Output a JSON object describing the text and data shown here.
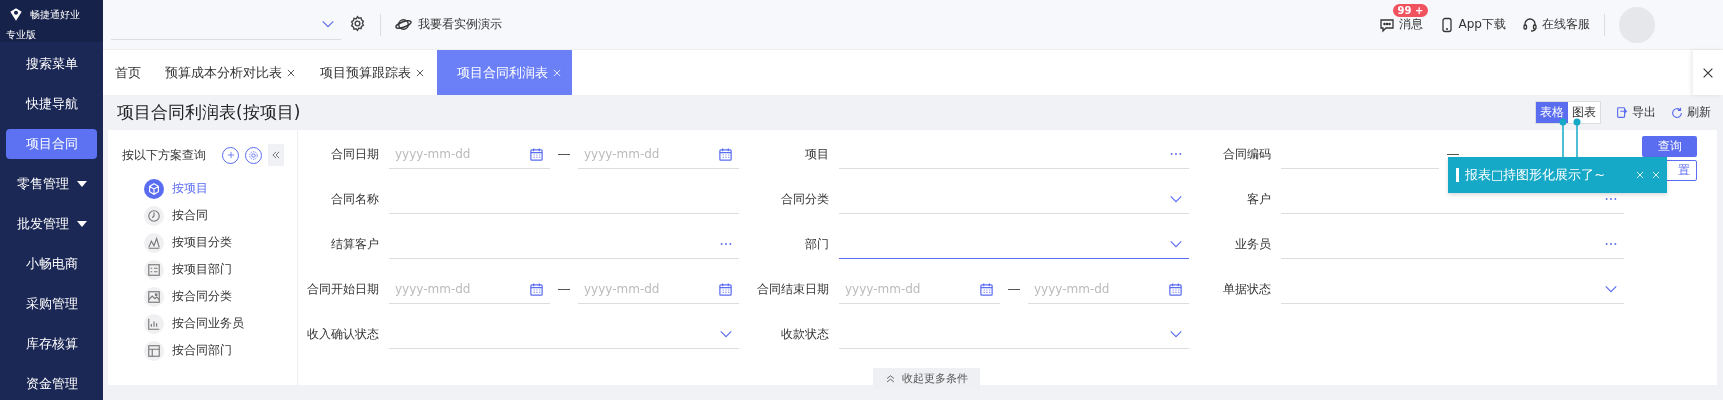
{
  "sidebar": {
    "brand": "畅捷通好业",
    "edition": "专业版",
    "items": [
      {
        "label": "搜索菜单",
        "selected": false,
        "expandable": false
      },
      {
        "label": "快捷导航",
        "selected": false,
        "expandable": false
      },
      {
        "label": "项目合同",
        "selected": true,
        "expandable": false
      },
      {
        "label": "零售管理",
        "selected": false,
        "expandable": true
      },
      {
        "label": "批发管理",
        "selected": false,
        "expandable": true
      },
      {
        "label": "小畅电商",
        "selected": false,
        "expandable": false
      },
      {
        "label": "采购管理",
        "selected": false,
        "expandable": false
      },
      {
        "label": "库存核算",
        "selected": false,
        "expandable": false
      },
      {
        "label": "资金管理",
        "selected": false,
        "expandable": false
      }
    ]
  },
  "topbar": {
    "demo_link": "我要看实例演示",
    "messages": {
      "label": "消息",
      "badge": "99 +"
    },
    "app_download": "App下载",
    "support": "在线客服"
  },
  "tabs": [
    {
      "label": "首页",
      "closable": false,
      "selected": false
    },
    {
      "label": "预算成本分析对比表",
      "closable": true,
      "selected": false
    },
    {
      "label": "项目预算跟踪表",
      "closable": true,
      "selected": false
    },
    {
      "label": "项目合同利润表",
      "closable": true,
      "selected": true
    }
  ],
  "page": {
    "title": "项目合同利润表(按项目)",
    "view_toggle": [
      {
        "label": "表格",
        "selected": true
      },
      {
        "label": "图表",
        "selected": false
      }
    ],
    "actions": [
      {
        "kind": "export",
        "label": "导出"
      },
      {
        "kind": "refresh",
        "label": "刷新"
      }
    ]
  },
  "schemes": {
    "title": "按以下方案查询",
    "items": [
      {
        "label": "按项目",
        "kind": "cube",
        "selected": true
      },
      {
        "label": "按合同",
        "kind": "clock",
        "selected": false
      },
      {
        "label": "按项目分类",
        "kind": "line",
        "selected": false
      },
      {
        "label": "按项目部门",
        "kind": "list",
        "selected": false
      },
      {
        "label": "按合同分类",
        "kind": "image",
        "selected": false
      },
      {
        "label": "按合同业务员",
        "kind": "bars",
        "selected": false
      },
      {
        "label": "按合同部门",
        "kind": "layout",
        "selected": false
      }
    ]
  },
  "form": {
    "fields": [
      {
        "label": "合同日期",
        "kind": "date_range",
        "placeholder_from": "yyyy-mm-dd",
        "placeholder_to": "yyyy-mm-dd",
        "focused": false
      },
      {
        "label": "项目",
        "kind": "lookup",
        "focused": false
      },
      {
        "label": "合同编码",
        "kind": "text_range",
        "focused": false
      },
      {
        "label": "合同名称",
        "kind": "text",
        "focused": false
      },
      {
        "label": "合同分类",
        "kind": "select",
        "focused": false
      },
      {
        "label": "客户",
        "kind": "lookup",
        "focused": false
      },
      {
        "label": "结算客户",
        "kind": "lookup",
        "focused": false
      },
      {
        "label": "部门",
        "kind": "select",
        "focused": true
      },
      {
        "label": "业务员",
        "kind": "lookup",
        "focused": false
      },
      {
        "label": "合同开始日期",
        "kind": "date_range",
        "placeholder_from": "yyyy-mm-dd",
        "placeholder_to": "yyyy-mm-dd",
        "focused": false
      },
      {
        "label": "合同结束日期",
        "kind": "date_range",
        "placeholder_from": "yyyy-mm-dd",
        "placeholder_to": "yyyy-mm-dd",
        "focused": false
      },
      {
        "label": "单据状态",
        "kind": "select",
        "focused": false
      },
      {
        "label": "收入确认状态",
        "kind": "select",
        "focused": false
      },
      {
        "label": "收款状态",
        "kind": "select",
        "focused": false
      }
    ],
    "buttons": [
      {
        "kind": "primary",
        "label": "查询"
      },
      {
        "kind": "secondary",
        "label": "置"
      }
    ],
    "collapse": "收起更多条件"
  },
  "tooltip": {
    "text": "报表□持图形化展示了~"
  }
}
